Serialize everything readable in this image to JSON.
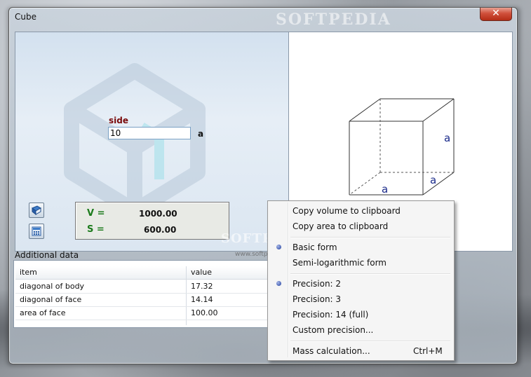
{
  "window": {
    "title": "Cube",
    "close_glyph": "✕",
    "watermark": "SOFTPEDIA"
  },
  "input_panel": {
    "side_label": "side",
    "side_value": "10",
    "side_unit": "a",
    "volume_label": "V =",
    "volume_value": "1000.00",
    "area_label": "S =",
    "area_value": "600.00"
  },
  "diagram": {
    "edge_labels": [
      "a",
      "a",
      "a"
    ]
  },
  "additional_data": {
    "label": "Additional data",
    "columns": [
      "item",
      "value"
    ],
    "rows": [
      {
        "item": "diagonal of body",
        "value": "17.32"
      },
      {
        "item": "diagonal of face",
        "value": "14.14"
      },
      {
        "item": "area of face",
        "value": "100.00"
      }
    ]
  },
  "context_menu": {
    "items": [
      {
        "label": "Copy volume to clipboard",
        "shortcut": "",
        "checked": false
      },
      {
        "label": "Copy area to clipboard",
        "shortcut": "",
        "checked": false
      },
      {
        "label": "Basic form",
        "shortcut": "",
        "checked": true
      },
      {
        "label": "Semi-logarithmic form",
        "shortcut": "",
        "checked": false
      },
      {
        "label": "Precision: 2",
        "shortcut": "",
        "checked": true
      },
      {
        "label": "Precision: 3",
        "shortcut": "",
        "checked": false
      },
      {
        "label": "Precision: 14 (full)",
        "shortcut": "",
        "checked": false
      },
      {
        "label": "Custom precision...",
        "shortcut": "",
        "checked": false
      },
      {
        "label": "Mass calculation...",
        "shortcut": "Ctrl+M",
        "checked": false
      }
    ]
  },
  "watermarks": {
    "mid": "SOFTPEDIA",
    "url": "www.softpedia.com"
  },
  "icons": [
    "book-icon",
    "calculator-icon",
    "paint-icon",
    "pencil-icon"
  ],
  "colors": {
    "side_label": "#7a0a0a",
    "result_label": "#1b7a1b",
    "edge_label": "#1a2a8a",
    "close_button": "#c94a35",
    "checked_dot": "#1c3b9c"
  }
}
